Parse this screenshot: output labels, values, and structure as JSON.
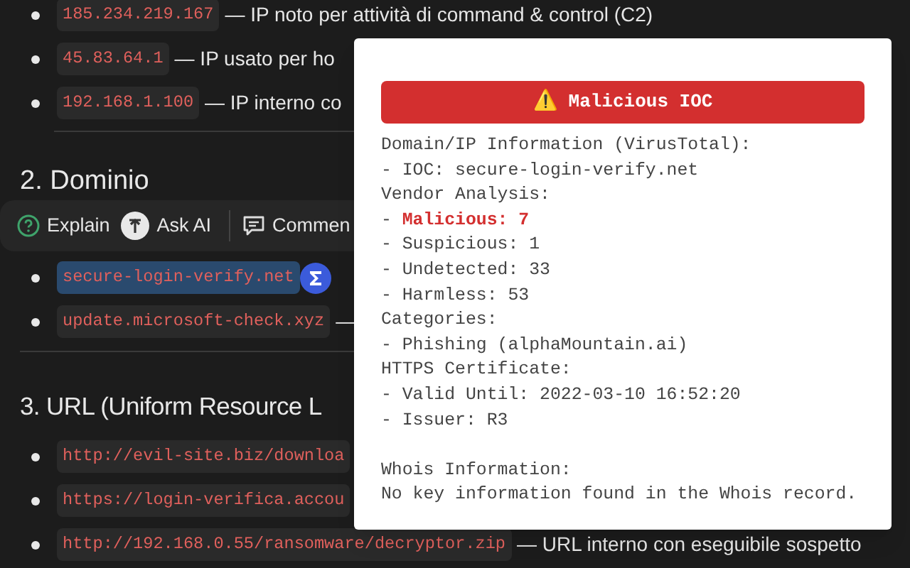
{
  "section_1": {
    "items": [
      {
        "code": "185.234.219.167",
        "text": "— IP noto per attività di command & control (C2)"
      },
      {
        "code": "45.83.64.1",
        "text": "— IP usato per ho"
      },
      {
        "code": "192.168.1.100",
        "text": "— IP interno co"
      }
    ]
  },
  "section_2": {
    "heading": "2. Dominio",
    "items": [
      {
        "code": "secure-login-verify.net",
        "selected": true
      },
      {
        "code": "update.microsoft-check.xyz",
        "text": "—",
        "selected": false
      }
    ]
  },
  "toolbar": {
    "items": [
      {
        "kind": "explain",
        "label": "Explain"
      },
      {
        "kind": "ask",
        "label": "Ask AI"
      },
      {
        "kind": "comment",
        "label": "Commen"
      }
    ]
  },
  "section_3": {
    "heading": "3. URL (Uniform Resource L",
    "items": [
      {
        "code": "http://evil-site.biz/downloa"
      },
      {
        "code": "https://login-verifica.accou"
      },
      {
        "code": "http://192.168.0.55/ransomware/decryptor.zip",
        "text": "— URL interno con eseguibile sospetto"
      }
    ]
  },
  "popup": {
    "banner": {
      "icon": "⚠️",
      "title": "Malicious IOC"
    },
    "blocks": [
      {
        "lines": [
          {
            "kind": "plain",
            "text": "Domain/IP Information (VirusTotal):"
          },
          {
            "kind": "plain",
            "text": "- IOC: secure-login-verify.net"
          },
          {
            "kind": "plain",
            "text": "Vendor Analysis:"
          },
          {
            "kind": "alert",
            "text": "- **Malicious: 7**"
          },
          {
            "kind": "plain",
            "text": "- Suspicious: 1"
          },
          {
            "kind": "plain",
            "text": "- Undetected: 33"
          },
          {
            "kind": "plain",
            "text": "- Harmless: 53"
          },
          {
            "kind": "plain",
            "text": "Categories:"
          },
          {
            "kind": "plain",
            "text": "- Phishing (alphaMountain.ai)"
          },
          {
            "kind": "plain",
            "text": "HTTPS Certificate:"
          },
          {
            "kind": "plain",
            "text": "- Valid Until: 2022-03-10 16:52:20"
          },
          {
            "kind": "plain",
            "text": "- Issuer: R3"
          }
        ]
      },
      {
        "lines": [
          {
            "kind": "plain",
            "text": "Whois Information:"
          },
          {
            "kind": "plain",
            "text": "No key information found in the Whois record."
          }
        ]
      }
    ]
  }
}
